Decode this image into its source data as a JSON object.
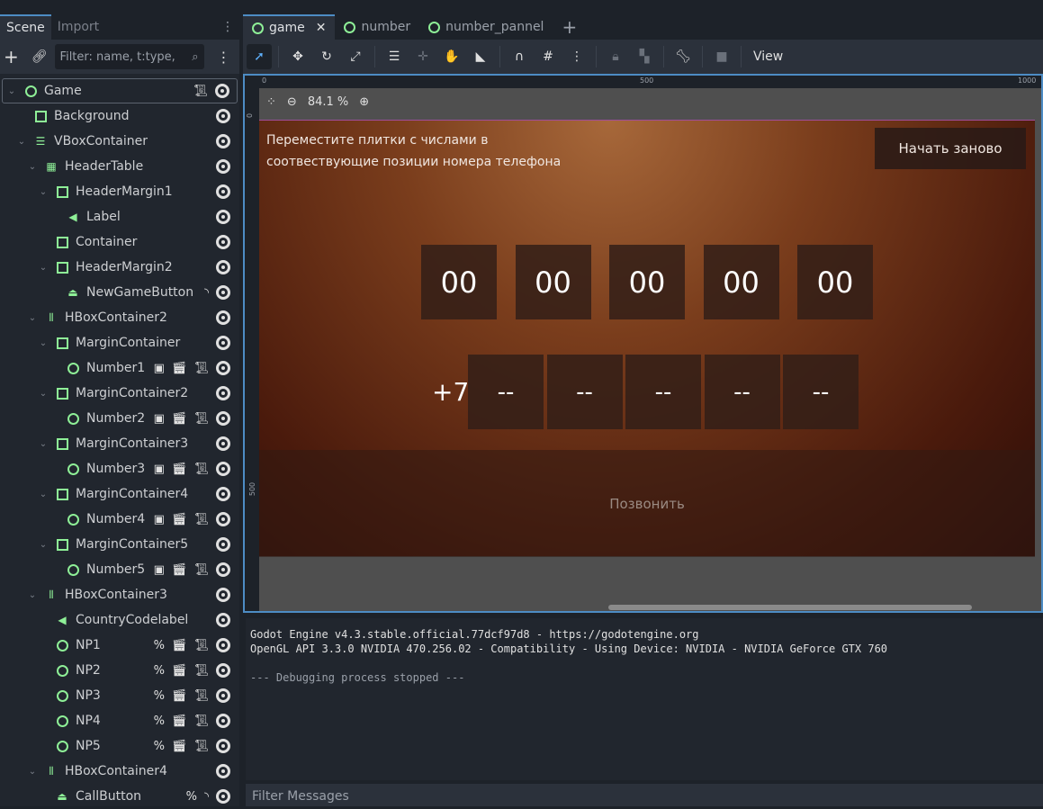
{
  "scene_dock": {
    "tabs": [
      "Scene",
      "Import"
    ],
    "filter_placeholder": "Filter: name, t:type,",
    "nodes": [
      {
        "name": "Game",
        "depth": 0,
        "icon": "node2d-circle",
        "chevron": true,
        "extras": [
          "script"
        ],
        "selected": true
      },
      {
        "name": "Background",
        "depth": 1,
        "icon": "texture-rect",
        "chevron": false,
        "extras": []
      },
      {
        "name": "VBoxContainer",
        "depth": 1,
        "icon": "vbox",
        "chevron": true,
        "extras": []
      },
      {
        "name": "HeaderTable",
        "depth": 2,
        "icon": "grid",
        "chevron": true,
        "extras": []
      },
      {
        "name": "HeaderMargin1",
        "depth": 3,
        "icon": "margin",
        "chevron": true,
        "extras": []
      },
      {
        "name": "Label",
        "depth": 4,
        "icon": "label",
        "chevron": false,
        "extras": []
      },
      {
        "name": "Container",
        "depth": 3,
        "icon": "margin",
        "chevron": false,
        "extras": []
      },
      {
        "name": "HeaderMargin2",
        "depth": 3,
        "icon": "margin",
        "chevron": true,
        "extras": []
      },
      {
        "name": "NewGameButton",
        "depth": 4,
        "icon": "button",
        "chevron": false,
        "extras": [
          "signal"
        ]
      },
      {
        "name": "HBoxContainer2",
        "depth": 2,
        "icon": "hbox",
        "chevron": true,
        "extras": []
      },
      {
        "name": "MarginContainer",
        "depth": 3,
        "icon": "margin",
        "chevron": true,
        "extras": []
      },
      {
        "name": "Number1",
        "depth": 4,
        "icon": "node2d-circle",
        "chevron": false,
        "extras": [
          "instance",
          "scene",
          "script"
        ]
      },
      {
        "name": "MarginContainer2",
        "depth": 3,
        "icon": "margin",
        "chevron": true,
        "extras": []
      },
      {
        "name": "Number2",
        "depth": 4,
        "icon": "node2d-circle",
        "chevron": false,
        "extras": [
          "instance",
          "scene",
          "script"
        ]
      },
      {
        "name": "MarginContainer3",
        "depth": 3,
        "icon": "margin",
        "chevron": true,
        "extras": []
      },
      {
        "name": "Number3",
        "depth": 4,
        "icon": "node2d-circle",
        "chevron": false,
        "extras": [
          "instance",
          "scene",
          "script"
        ]
      },
      {
        "name": "MarginContainer4",
        "depth": 3,
        "icon": "margin",
        "chevron": true,
        "extras": []
      },
      {
        "name": "Number4",
        "depth": 4,
        "icon": "node2d-circle",
        "chevron": false,
        "extras": [
          "instance",
          "scene",
          "script"
        ]
      },
      {
        "name": "MarginContainer5",
        "depth": 3,
        "icon": "margin",
        "chevron": true,
        "extras": []
      },
      {
        "name": "Number5",
        "depth": 4,
        "icon": "node2d-circle",
        "chevron": false,
        "extras": [
          "instance",
          "scene",
          "script"
        ]
      },
      {
        "name": "HBoxContainer3",
        "depth": 2,
        "icon": "hbox",
        "chevron": true,
        "extras": []
      },
      {
        "name": "CountryCodelabel",
        "depth": 3,
        "icon": "label",
        "chevron": false,
        "extras": []
      },
      {
        "name": "NP1",
        "depth": 3,
        "icon": "node2d-circle",
        "chevron": false,
        "extras": [
          "unique",
          "scene",
          "script"
        ]
      },
      {
        "name": "NP2",
        "depth": 3,
        "icon": "node2d-circle",
        "chevron": false,
        "extras": [
          "unique",
          "scene",
          "script"
        ]
      },
      {
        "name": "NP3",
        "depth": 3,
        "icon": "node2d-circle",
        "chevron": false,
        "extras": [
          "unique",
          "scene",
          "script"
        ]
      },
      {
        "name": "NP4",
        "depth": 3,
        "icon": "node2d-circle",
        "chevron": false,
        "extras": [
          "unique",
          "scene",
          "script"
        ]
      },
      {
        "name": "NP5",
        "depth": 3,
        "icon": "node2d-circle",
        "chevron": false,
        "extras": [
          "unique",
          "scene",
          "script"
        ]
      },
      {
        "name": "HBoxContainer4",
        "depth": 2,
        "icon": "hbox",
        "chevron": true,
        "extras": []
      },
      {
        "name": "CallButton",
        "depth": 3,
        "icon": "button",
        "chevron": false,
        "extras": [
          "unique",
          "signal"
        ]
      }
    ]
  },
  "editor": {
    "tabs": [
      "game",
      "number",
      "number_pannel"
    ],
    "view_label": "View",
    "zoom": "84.1 %",
    "ruler_h": [
      "0",
      "500",
      "1000"
    ],
    "ruler_v": [
      "0",
      "500"
    ]
  },
  "game": {
    "instruction_line1": "Переместите плитки с числами  в",
    "instruction_line2": "соотвествующие позиции номера телефона",
    "restart": "Начать заново",
    "tiles": [
      "00",
      "00",
      "00",
      "00",
      "00"
    ],
    "country_code": "+7",
    "slots": [
      "--",
      "--",
      "--",
      "--",
      "--"
    ],
    "call": "Позвонить"
  },
  "output": {
    "lines": [
      "Godot Engine v4.3.stable.official.77dcf97d8 - https://godotengine.org",
      "OpenGL API 3.3.0 NVIDIA 470.256.02 - Compatibility - Using Device: NVIDIA - NVIDIA GeForce GTX 760",
      "",
      "--- Debugging process stopped ---"
    ],
    "filter_placeholder": "Filter Messages"
  },
  "colors": {
    "accent": "#4d8cc4",
    "node_green": "#8eef97",
    "bg": "#21262e"
  }
}
